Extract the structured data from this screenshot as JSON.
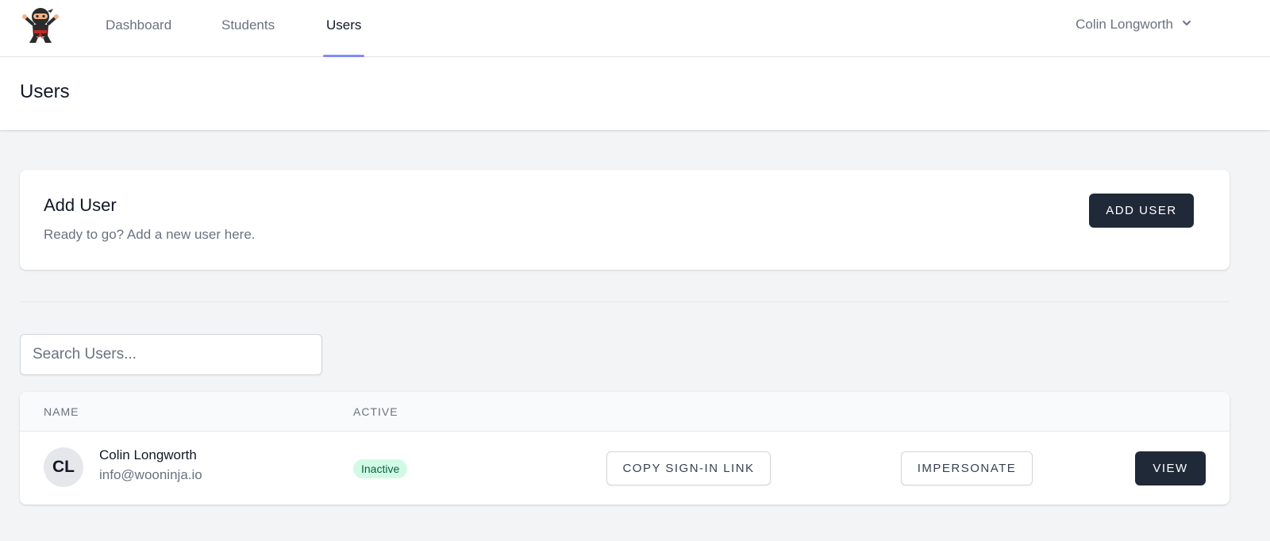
{
  "nav": {
    "logo_alt": "ninja-logo",
    "links": [
      {
        "label": "Dashboard"
      },
      {
        "label": "Students"
      },
      {
        "label": "Users"
      }
    ],
    "user_name": "Colin Longworth"
  },
  "page": {
    "title": "Users"
  },
  "add_user_card": {
    "title": "Add User",
    "subtitle": "Ready to go? Add a new user here.",
    "button_label": "ADD USER"
  },
  "search": {
    "placeholder": "Search Users...",
    "value": ""
  },
  "table": {
    "columns": [
      "NAME",
      "ACTIVE"
    ],
    "rows": [
      {
        "initials": "CL",
        "name": "Colin Longworth",
        "email": "info@wooninja.io",
        "status": "Inactive",
        "actions": {
          "copy": "COPY SIGN-IN LINK",
          "impersonate": "IMPERSONATE",
          "view": "VIEW"
        }
      }
    ]
  },
  "colors": {
    "accent": "#818cf8",
    "dark_button": "#1f2937",
    "badge_bg": "#d1fae5",
    "badge_text": "#065f46",
    "page_bg": "#f3f4f6"
  }
}
